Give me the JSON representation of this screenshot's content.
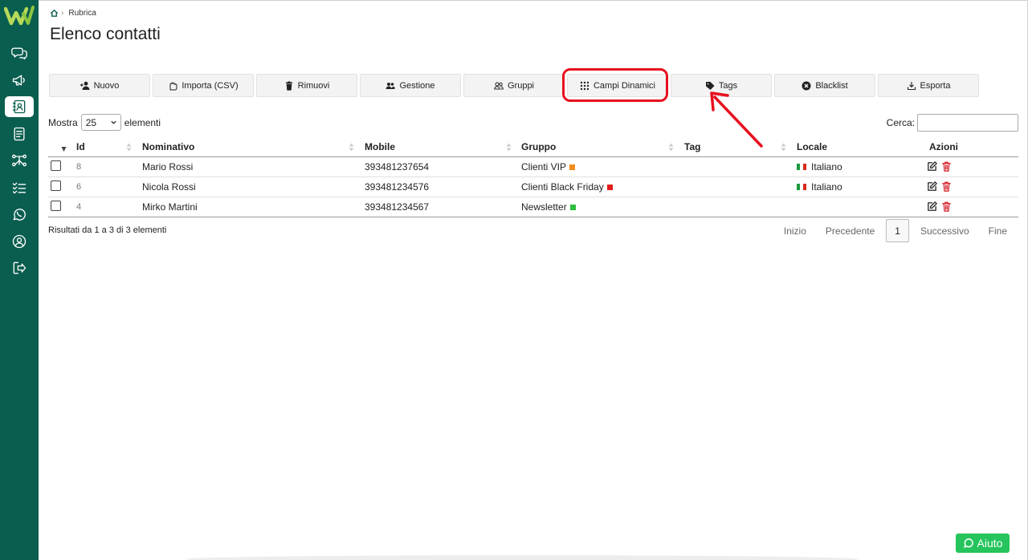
{
  "breadcrumb": {
    "current": "Rubrica"
  },
  "page": {
    "title": "Elenco contatti"
  },
  "toolbar": {
    "buttons": [
      {
        "label": "Nuovo",
        "icon": "user-plus-icon"
      },
      {
        "label": "Importa (CSV)",
        "icon": "hand-upload-icon"
      },
      {
        "label": "Rimuovi",
        "icon": "trash-icon"
      },
      {
        "label": "Gestione",
        "icon": "users-icon"
      },
      {
        "label": "Gruppi",
        "icon": "users-outline-icon"
      },
      {
        "label": "Campi Dinamici",
        "icon": "grid-dots-icon"
      },
      {
        "label": "Tags",
        "icon": "tag-icon"
      },
      {
        "label": "Blacklist",
        "icon": "x-circle-icon"
      },
      {
        "label": "Esporta",
        "icon": "download-icon"
      }
    ]
  },
  "table_controls": {
    "show_prefix": "Mostra",
    "page_size": "25",
    "show_suffix": "elementi",
    "search_label": "Cerca:",
    "search_value": ""
  },
  "table": {
    "headers": [
      "Id",
      "Nominativo",
      "Mobile",
      "Gruppo",
      "Tag",
      "Locale",
      "Azioni"
    ],
    "rows": [
      {
        "id": "8",
        "name": "Mario Rossi",
        "mobile": "393481237654",
        "group": "Clienti VIP",
        "group_color": "#f28c1e",
        "tag": "",
        "locale": "Italiano",
        "has_flag": true
      },
      {
        "id": "6",
        "name": "Nicola Rossi",
        "mobile": "393481234576",
        "group": "Clienti Black Friday",
        "group_color": "#e31b1b",
        "tag": "",
        "locale": "Italiano",
        "has_flag": true
      },
      {
        "id": "4",
        "name": "Mirko Martini",
        "mobile": "393481234567",
        "group": "Newsletter",
        "group_color": "#2ebd3d",
        "tag": "",
        "locale": "",
        "has_flag": false
      }
    ]
  },
  "footer": {
    "results": "Risultati da 1 a 3 di 3 elementi",
    "pager": {
      "first": "Inizio",
      "prev": "Precedente",
      "current": "1",
      "next": "Successivo",
      "last": "Fine"
    }
  },
  "help": {
    "label": "Aiuto"
  },
  "colors": {
    "sidebar": "#0a5e4f",
    "highlight": "#e8101e",
    "help": "#25c45c"
  }
}
